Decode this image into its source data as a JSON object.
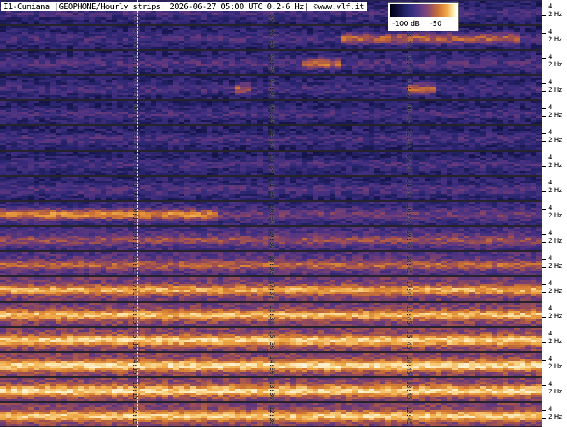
{
  "title": "I1-Cumiana |GEOPHONE/Hourly strips| 2026-06-27 05:00 UTC 0.2-6 Hz| ©www.vlf.it",
  "legend": {
    "min_label": "-100 dB",
    "max_label": "-50"
  },
  "axis": {
    "upper_tick": "4",
    "lower_tick": "2 Hz"
  },
  "strips": [
    {
      "labels": [
        "04:15",
        "04:30",
        ""
      ],
      "intensity": 0.22,
      "hot": []
    },
    {
      "labels": [
        "03:15",
        "03:30",
        "03:45"
      ],
      "intensity": 0.22,
      "hot": [
        [
          0.62,
          0.95
        ]
      ]
    },
    {
      "labels": [
        "02:15",
        "02:30",
        "02:45"
      ],
      "intensity": 0.24,
      "hot": [
        [
          0.55,
          0.62
        ]
      ]
    },
    {
      "labels": [
        "01:15",
        "01:30",
        "01:45"
      ],
      "intensity": 0.22,
      "hot": [
        [
          0.43,
          0.46
        ],
        [
          0.75,
          0.8
        ]
      ]
    },
    {
      "labels": [
        "00:15",
        "00:30",
        "00:45"
      ],
      "intensity": 0.22,
      "hot": []
    },
    {
      "labels": [
        "23:15",
        "23:30",
        "23:45"
      ],
      "intensity": 0.22,
      "hot": []
    },
    {
      "labels": [
        "22:15",
        "22:30",
        "22:45"
      ],
      "intensity": 0.22,
      "hot": []
    },
    {
      "labels": [
        "21:15",
        "21:30",
        "21:45"
      ],
      "intensity": 0.24,
      "hot": []
    },
    {
      "labels": [
        "20:15",
        "20:30",
        "20:45"
      ],
      "intensity": 0.32,
      "hot": [
        [
          0.0,
          0.4
        ]
      ]
    },
    {
      "labels": [
        "19:15",
        "19:30",
        "19:45"
      ],
      "intensity": 0.42,
      "hot": []
    },
    {
      "labels": [
        "18:15",
        "18:30",
        "18:45"
      ],
      "intensity": 0.5,
      "hot": []
    },
    {
      "labels": [
        "17:15",
        "17:30",
        "17:45"
      ],
      "intensity": 0.66,
      "hot": []
    },
    {
      "labels": [
        "16:15",
        "16:30",
        "16:45"
      ],
      "intensity": 0.7,
      "hot": []
    },
    {
      "labels": [
        "15:15",
        "15:30",
        "15:45"
      ],
      "intensity": 0.74,
      "hot": []
    },
    {
      "labels": [
        "14:15",
        "14:30",
        "14:45"
      ],
      "intensity": 0.76,
      "hot": []
    },
    {
      "labels": [
        "13:15",
        "13:30",
        "13:45"
      ],
      "intensity": 0.76,
      "hot": []
    },
    {
      "labels": [
        "12:15",
        "12:30",
        "12:45"
      ],
      "intensity": 0.74,
      "hot": []
    }
  ]
}
